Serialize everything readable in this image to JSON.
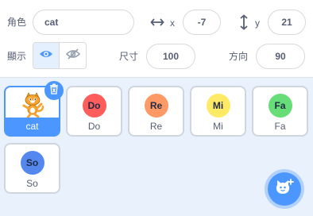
{
  "sprite_info": {
    "sprite_label": "角色",
    "sprite_name": "cat",
    "x_label": "x",
    "x_value": "-7",
    "y_label": "y",
    "y_value": "21",
    "show_label": "顯示",
    "size_label": "尺寸",
    "size_value": "100",
    "direction_label": "方向",
    "direction_value": "90"
  },
  "sprites": [
    {
      "name": "cat",
      "thumb": "cat-costume",
      "selected": true
    },
    {
      "name": "Do",
      "thumb": "Do",
      "color": "#ff5c5c"
    },
    {
      "name": "Re",
      "thumb": "Re",
      "color": "#ff9966"
    },
    {
      "name": "Mi",
      "thumb": "Mi",
      "color": "#ffea66"
    },
    {
      "name": "Fa",
      "thumb": "Fa",
      "color": "#66dd77"
    },
    {
      "name": "So",
      "thumb": "So",
      "color": "#5588ee"
    }
  ],
  "icons": {
    "x_icon": "horizontal-arrows-icon",
    "y_icon": "vertical-arrows-icon",
    "show": "eye-icon",
    "hide": "eye-slash-icon",
    "delete": "trash-icon",
    "add_sprite": "cat-plus-icon"
  },
  "colors": {
    "accent": "#4c97ff",
    "panel_bg": "#e9f1fc"
  }
}
